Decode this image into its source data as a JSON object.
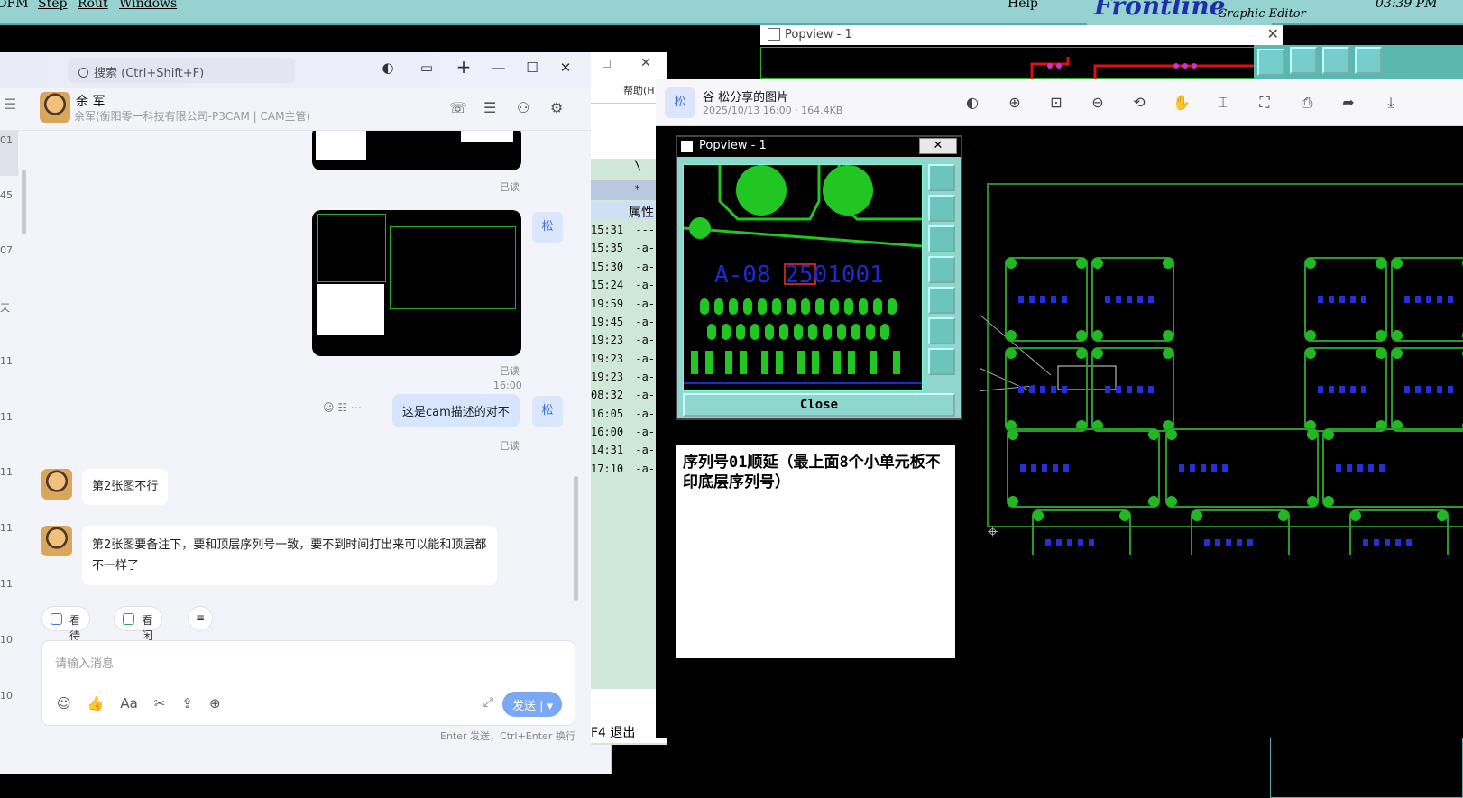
{
  "frontline": {
    "menu": [
      "OFM",
      "Step",
      "Rout",
      "Windows"
    ],
    "help": "Help",
    "brand": "Frontline",
    "subtitle": "Graphic Editor",
    "time": "03:39 PM"
  },
  "chat": {
    "search_placeholder": "搜索 (Ctrl+Shift+F)",
    "contact_name": "余 军",
    "contact_sub": "余军(衡阳零一科技有限公司-P3CAM | CAM主管)",
    "left_numbers": [
      "01",
      "45",
      "07",
      "天",
      "11",
      "11",
      "11",
      "11",
      "11",
      "10",
      "10"
    ],
    "read_label": "已读",
    "time_stamp": "16:00",
    "my_avatar": "松",
    "my_message": "这是cam描述的对不",
    "messages": [
      {
        "text": "第2张图不行"
      },
      {
        "text": "第2张图要备注下，要和顶层序列号一致，要不到时间打出来可以能和顶层都不一样了"
      }
    ],
    "quick_actions": [
      "看待办",
      "看闲忙"
    ],
    "input_placeholder": "请输入消息",
    "send_label": "发送",
    "send_hint": "Enter 发送，Ctrl+Enter 换行"
  },
  "file_manager": {
    "help_label": "帮助(H",
    "col_header": "属性",
    "rows": [
      {
        "time": "15:31",
        "attr": "----"
      },
      {
        "time": "15:35",
        "attr": "-a--"
      },
      {
        "time": "15:30",
        "attr": "-a--"
      },
      {
        "time": "15:24",
        "attr": "-a--"
      },
      {
        "time": "19:59",
        "attr": "-a--"
      },
      {
        "time": "19:45",
        "attr": "-a--"
      },
      {
        "time": "19:23",
        "attr": "-a--"
      },
      {
        "time": "19:23",
        "attr": "-a--"
      },
      {
        "time": "19:23",
        "attr": "-a--"
      },
      {
        "time": "08:32",
        "attr": "-a--"
      },
      {
        "time": "16:05",
        "attr": "-a--"
      },
      {
        "time": "16:00",
        "attr": "-a--"
      },
      {
        "time": "14:31",
        "attr": "-a--"
      },
      {
        "time": "17:10",
        "attr": "-a--"
      }
    ],
    "footer": "F4 退出"
  },
  "popview_outer": {
    "title": "Popview - 1"
  },
  "viewer": {
    "avatar": "松",
    "title": "谷  松分享的图片",
    "meta": "2025/10/13 16:00 · 164.4KB"
  },
  "popview_inner": {
    "title": "Popview - 1",
    "close_x": "✕",
    "board_text": "A-08 2501001",
    "close_label": "Close"
  },
  "note_text": "序列号01顺延（最上面8个小单元板不印底层序列号）"
}
